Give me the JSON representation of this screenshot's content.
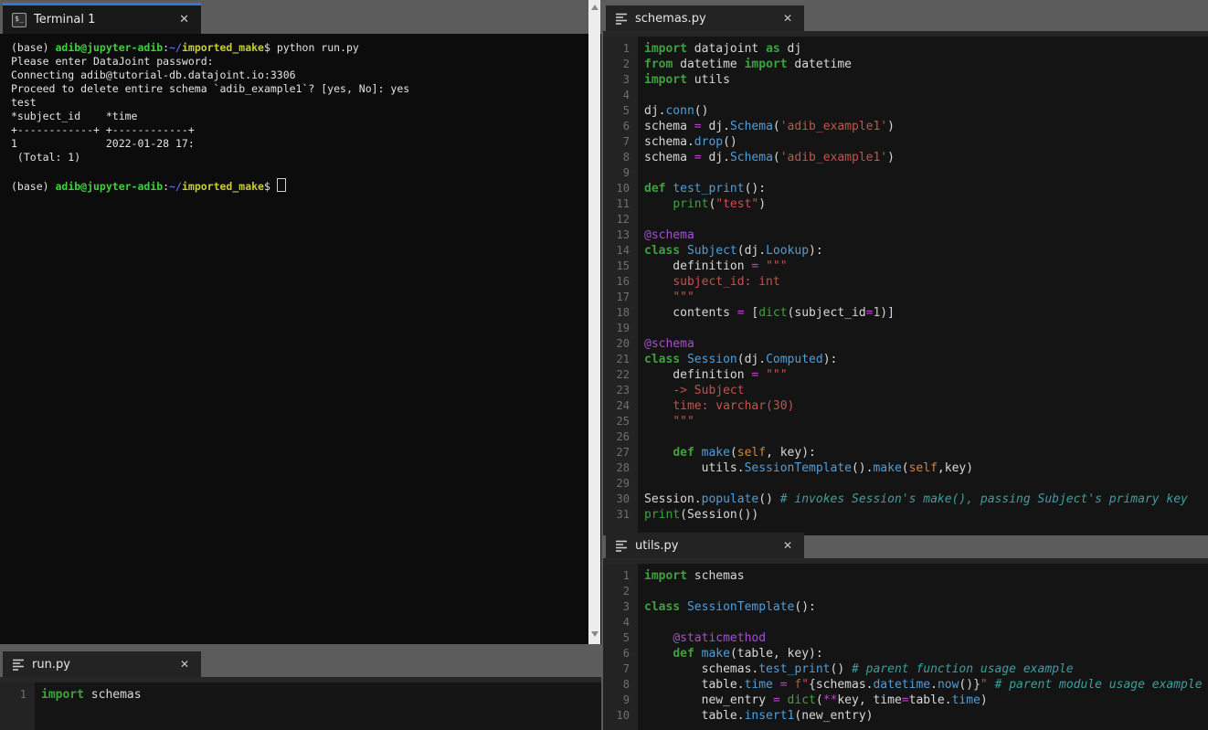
{
  "ui": {
    "close_glyph": "✕",
    "terminal_icon_glyph": "$_"
  },
  "colors": {
    "page_bg": "#5c5c5c",
    "active_tab_indicator": "#2b7cd9",
    "terminal_bg": "#0c0c0c",
    "editor_bg": "#141414",
    "gutter_bg": "#232323",
    "terminal_green": "#3fd03f",
    "terminal_blue": "#4a74e8",
    "terminal_yellow": "#cbcb3f",
    "code_keyword_green": "#3ea13e",
    "code_function_blue": "#4f9ed9",
    "code_string_red": "#c4534c",
    "code_comment_teal": "#3f9e9e",
    "code_decorator_purple": "#a44fd0",
    "code_operator_magenta": "#bc43c9",
    "code_self_orange": "#cf8542"
  },
  "terminal": {
    "tab_label": "Terminal 1",
    "lines": [
      [
        {
          "t": "(base) ",
          "s": "w"
        },
        {
          "t": "adib@jupyter-adib",
          "s": "g"
        },
        {
          "t": ":",
          "s": "w"
        },
        {
          "t": "~/",
          "s": "b"
        },
        {
          "t": "imported_make",
          "s": "y"
        },
        {
          "t": "$ python run.py",
          "s": "w"
        }
      ],
      [
        {
          "t": "Please enter DataJoint password:",
          "s": "w"
        }
      ],
      [
        {
          "t": "Connecting adib@tutorial-db.datajoint.io:3306",
          "s": "w"
        }
      ],
      [
        {
          "t": "Proceed to delete entire schema `adib_example1`? [yes, No]: yes",
          "s": "w"
        }
      ],
      [
        {
          "t": "test",
          "s": "w"
        }
      ],
      [
        {
          "t": "*subject_id    *time",
          "s": "w"
        }
      ],
      [
        {
          "t": "+------------+ +------------+",
          "s": "w"
        }
      ],
      [
        {
          "t": "1              2022-01-28 17:",
          "s": "w"
        }
      ],
      [
        {
          "t": " (Total: 1)",
          "s": "w"
        }
      ],
      [
        {
          "t": "",
          "s": "w"
        }
      ],
      [
        {
          "t": "(base) ",
          "s": "w"
        },
        {
          "t": "adib@jupyter-adib",
          "s": "g"
        },
        {
          "t": ":",
          "s": "w"
        },
        {
          "t": "~/",
          "s": "b"
        },
        {
          "t": "imported_make",
          "s": "y"
        },
        {
          "t": "$ ",
          "s": "w"
        },
        {
          "t": "",
          "s": "cur"
        }
      ]
    ]
  },
  "editors": {
    "schemas": {
      "tab_label": "schemas.py",
      "lines": [
        [
          {
            "t": "import",
            "s": "kw"
          },
          {
            "t": " datajoint ",
            "s": "pl"
          },
          {
            "t": "as",
            "s": "kw"
          },
          {
            "t": " dj",
            "s": "pl"
          }
        ],
        [
          {
            "t": "from",
            "s": "kw"
          },
          {
            "t": " datetime ",
            "s": "pl"
          },
          {
            "t": "import",
            "s": "kw"
          },
          {
            "t": " datetime",
            "s": "pl"
          }
        ],
        [
          {
            "t": "import",
            "s": "kw"
          },
          {
            "t": " utils",
            "s": "pl"
          }
        ],
        [],
        [
          {
            "t": "dj.",
            "s": "pl"
          },
          {
            "t": "conn",
            "s": "fn"
          },
          {
            "t": "()",
            "s": "pl"
          }
        ],
        [
          {
            "t": "schema ",
            "s": "pl"
          },
          {
            "t": "=",
            "s": "op"
          },
          {
            "t": " dj.",
            "s": "pl"
          },
          {
            "t": "Schema",
            "s": "fn"
          },
          {
            "t": "(",
            "s": "pl"
          },
          {
            "t": "'adib_example1'",
            "s": "str"
          },
          {
            "t": ")",
            "s": "pl"
          }
        ],
        [
          {
            "t": "schema.",
            "s": "pl"
          },
          {
            "t": "drop",
            "s": "fn"
          },
          {
            "t": "()",
            "s": "pl"
          }
        ],
        [
          {
            "t": "schema ",
            "s": "pl"
          },
          {
            "t": "=",
            "s": "op"
          },
          {
            "t": " dj.",
            "s": "pl"
          },
          {
            "t": "Schema",
            "s": "fn"
          },
          {
            "t": "(",
            "s": "pl"
          },
          {
            "t": "'adib_example1'",
            "s": "str"
          },
          {
            "t": ")",
            "s": "pl"
          }
        ],
        [],
        [
          {
            "t": "def",
            "s": "kw"
          },
          {
            "t": " ",
            "s": "pl"
          },
          {
            "t": "test_print",
            "s": "fn"
          },
          {
            "t": "():",
            "s": "pl"
          }
        ],
        [
          {
            "t": "    ",
            "s": "pl"
          },
          {
            "t": "print",
            "s": "bi"
          },
          {
            "t": "(",
            "s": "pl"
          },
          {
            "t": "\"test\"",
            "s": "str"
          },
          {
            "t": ")",
            "s": "pl"
          }
        ],
        [],
        [
          {
            "t": "@schema",
            "s": "dec"
          }
        ],
        [
          {
            "t": "class",
            "s": "kw"
          },
          {
            "t": " ",
            "s": "pl"
          },
          {
            "t": "Subject",
            "s": "fn"
          },
          {
            "t": "(dj.",
            "s": "pl"
          },
          {
            "t": "Lookup",
            "s": "fn"
          },
          {
            "t": "):",
            "s": "pl"
          }
        ],
        [
          {
            "t": "    definition ",
            "s": "pl"
          },
          {
            "t": "=",
            "s": "op"
          },
          {
            "t": " ",
            "s": "pl"
          },
          {
            "t": "\"\"\"",
            "s": "str"
          }
        ],
        [
          {
            "t": "    ",
            "s": "pl"
          },
          {
            "t": "subject_id: int",
            "s": "str"
          }
        ],
        [
          {
            "t": "    ",
            "s": "pl"
          },
          {
            "t": "\"\"\"",
            "s": "str"
          }
        ],
        [
          {
            "t": "    contents ",
            "s": "pl"
          },
          {
            "t": "=",
            "s": "op"
          },
          {
            "t": " [",
            "s": "pl"
          },
          {
            "t": "dict",
            "s": "bi"
          },
          {
            "t": "(subject_id",
            "s": "pl"
          },
          {
            "t": "=",
            "s": "op"
          },
          {
            "t": "1",
            "s": "num"
          },
          {
            "t": ")]",
            "s": "pl"
          }
        ],
        [],
        [
          {
            "t": "@schema",
            "s": "dec"
          }
        ],
        [
          {
            "t": "class",
            "s": "kw"
          },
          {
            "t": " ",
            "s": "pl"
          },
          {
            "t": "Session",
            "s": "fn"
          },
          {
            "t": "(dj.",
            "s": "pl"
          },
          {
            "t": "Computed",
            "s": "fn"
          },
          {
            "t": "):",
            "s": "pl"
          }
        ],
        [
          {
            "t": "    definition ",
            "s": "pl"
          },
          {
            "t": "=",
            "s": "op"
          },
          {
            "t": " ",
            "s": "pl"
          },
          {
            "t": "\"\"\"",
            "s": "str"
          }
        ],
        [
          {
            "t": "    ",
            "s": "pl"
          },
          {
            "t": "-> Subject",
            "s": "str"
          }
        ],
        [
          {
            "t": "    ",
            "s": "pl"
          },
          {
            "t": "time: varchar(30)",
            "s": "str"
          }
        ],
        [
          {
            "t": "    ",
            "s": "pl"
          },
          {
            "t": "\"\"\"",
            "s": "str"
          }
        ],
        [],
        [
          {
            "t": "    ",
            "s": "pl"
          },
          {
            "t": "def",
            "s": "kw"
          },
          {
            "t": " ",
            "s": "pl"
          },
          {
            "t": "make",
            "s": "fn"
          },
          {
            "t": "(",
            "s": "pl"
          },
          {
            "t": "self",
            "s": "slf"
          },
          {
            "t": ", key):",
            "s": "pl"
          }
        ],
        [
          {
            "t": "        utils.",
            "s": "pl"
          },
          {
            "t": "SessionTemplate",
            "s": "fn"
          },
          {
            "t": "().",
            "s": "pl"
          },
          {
            "t": "make",
            "s": "fn"
          },
          {
            "t": "(",
            "s": "pl"
          },
          {
            "t": "self",
            "s": "slf"
          },
          {
            "t": ",key)",
            "s": "pl"
          }
        ],
        [],
        [
          {
            "t": "Session.",
            "s": "pl"
          },
          {
            "t": "populate",
            "s": "fn"
          },
          {
            "t": "() ",
            "s": "pl"
          },
          {
            "t": "# invokes Session's make(), passing Subject's primary key",
            "s": "com"
          }
        ],
        [
          {
            "t": "print",
            "s": "bi"
          },
          {
            "t": "(Session())",
            "s": "pl"
          }
        ]
      ]
    },
    "utils": {
      "tab_label": "utils.py",
      "lines": [
        [
          {
            "t": "import",
            "s": "kw"
          },
          {
            "t": " schemas",
            "s": "pl"
          }
        ],
        [],
        [
          {
            "t": "class",
            "s": "kw"
          },
          {
            "t": " ",
            "s": "pl"
          },
          {
            "t": "SessionTemplate",
            "s": "fn"
          },
          {
            "t": "():",
            "s": "pl"
          }
        ],
        [],
        [
          {
            "t": "    ",
            "s": "pl"
          },
          {
            "t": "@staticmethod",
            "s": "dec"
          }
        ],
        [
          {
            "t": "    ",
            "s": "pl"
          },
          {
            "t": "def",
            "s": "kw"
          },
          {
            "t": " ",
            "s": "pl"
          },
          {
            "t": "make",
            "s": "fn"
          },
          {
            "t": "(table, key):",
            "s": "pl"
          }
        ],
        [
          {
            "t": "        schemas.",
            "s": "pl"
          },
          {
            "t": "test_print",
            "s": "fn"
          },
          {
            "t": "() ",
            "s": "pl"
          },
          {
            "t": "# parent function usage example",
            "s": "com"
          }
        ],
        [
          {
            "t": "        table.",
            "s": "pl"
          },
          {
            "t": "time",
            "s": "fn"
          },
          {
            "t": " ",
            "s": "pl"
          },
          {
            "t": "=",
            "s": "op"
          },
          {
            "t": " ",
            "s": "pl"
          },
          {
            "t": "f\"",
            "s": "str"
          },
          {
            "t": "{schemas.",
            "s": "pl"
          },
          {
            "t": "datetime",
            "s": "fn"
          },
          {
            "t": ".",
            "s": "pl"
          },
          {
            "t": "now",
            "s": "fn"
          },
          {
            "t": "()}",
            "s": "pl"
          },
          {
            "t": "\"",
            "s": "str"
          },
          {
            "t": " ",
            "s": "pl"
          },
          {
            "t": "# parent module usage example",
            "s": "com"
          }
        ],
        [
          {
            "t": "        new_entry ",
            "s": "pl"
          },
          {
            "t": "=",
            "s": "op"
          },
          {
            "t": " ",
            "s": "pl"
          },
          {
            "t": "dict",
            "s": "bi"
          },
          {
            "t": "(",
            "s": "pl"
          },
          {
            "t": "**",
            "s": "op"
          },
          {
            "t": "key, time",
            "s": "pl"
          },
          {
            "t": "=",
            "s": "op"
          },
          {
            "t": "table.",
            "s": "pl"
          },
          {
            "t": "time",
            "s": "fn"
          },
          {
            "t": ")",
            "s": "pl"
          }
        ],
        [
          {
            "t": "        table.",
            "s": "pl"
          },
          {
            "t": "insert1",
            "s": "fn"
          },
          {
            "t": "(new_entry)",
            "s": "pl"
          }
        ]
      ]
    },
    "run": {
      "tab_label": "run.py",
      "lines": [
        [
          {
            "t": "import",
            "s": "kw"
          },
          {
            "t": " schemas",
            "s": "pl"
          }
        ]
      ]
    }
  }
}
